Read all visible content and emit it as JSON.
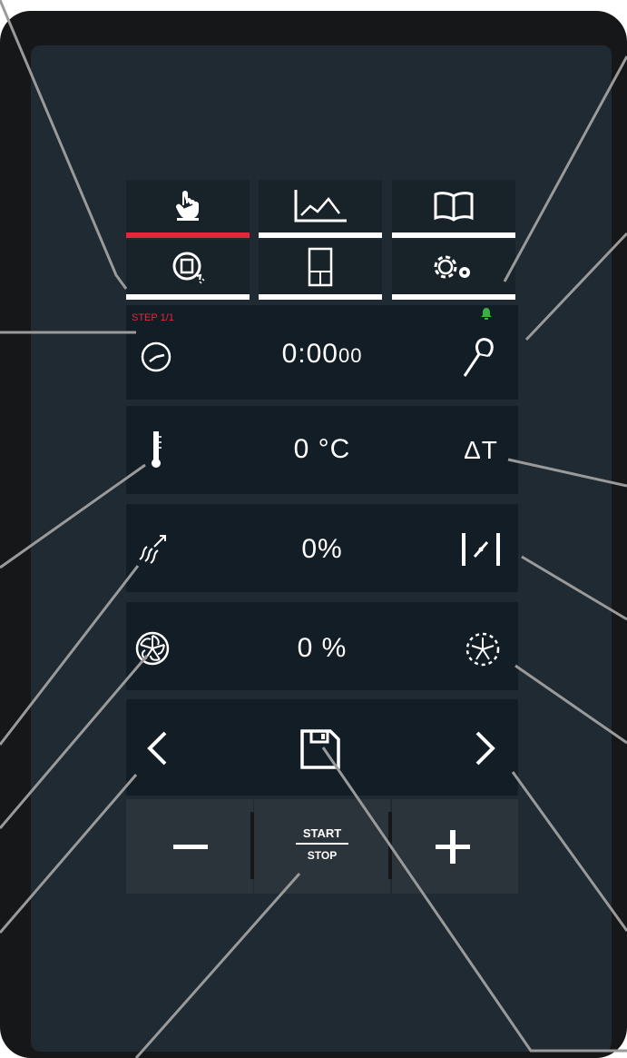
{
  "step_label": "STEP 1/1",
  "timer": {
    "main": "0:00",
    "seconds": "00"
  },
  "temperature": "0 °C",
  "humidity": "0%",
  "fan": "0 %",
  "delta_t_label": "ΔT",
  "start_stop": {
    "top": "START",
    "bottom": "STOP"
  },
  "controls": {
    "minus": "−",
    "plus": "+"
  },
  "tabs": [
    {
      "icon": "hand-pointer-icon",
      "active": true
    },
    {
      "icon": "line-chart-icon",
      "active": false
    },
    {
      "icon": "book-icon",
      "active": false
    },
    {
      "icon": "recipe-cycle-icon",
      "active": false
    },
    {
      "icon": "oven-door-icon",
      "active": false
    },
    {
      "icon": "settings-gears-icon",
      "active": false
    }
  ],
  "colors": {
    "accent": "#e2283b",
    "bell": "#3cb043",
    "screen": "#1f2a33",
    "panel": "#131d25"
  }
}
